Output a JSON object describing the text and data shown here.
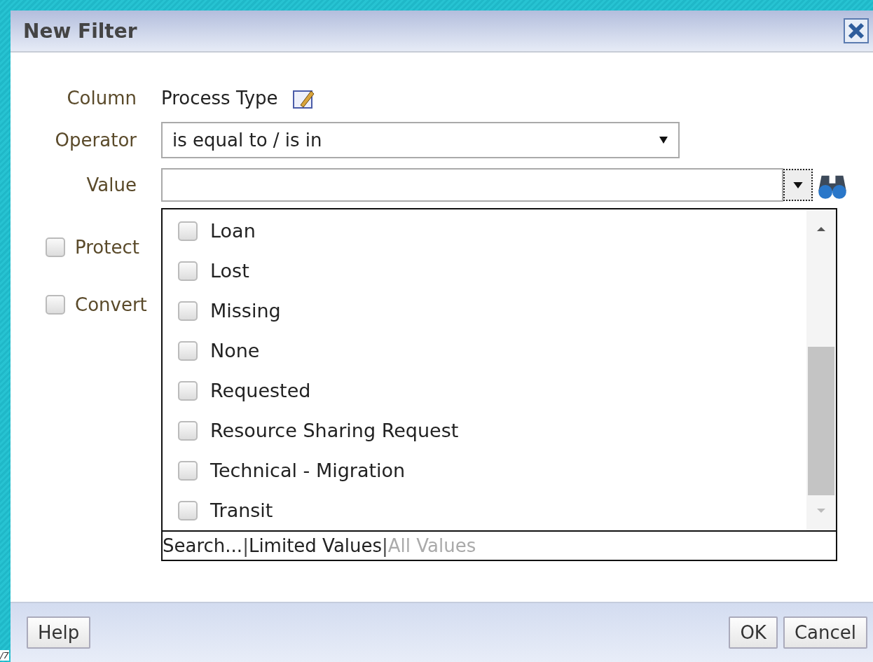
{
  "page_number": "/7",
  "dialog": {
    "title": "New Filter"
  },
  "form": {
    "column_label": "Column",
    "column_value": "Process Type",
    "operator_label": "Operator",
    "operator_value": "is equal to / is in",
    "value_label": "Value"
  },
  "options": [
    {
      "label": "Protect",
      "checked": false
    },
    {
      "label": "Convert",
      "checked": false
    }
  ],
  "value_list": {
    "items": [
      {
        "label": "Loan",
        "checked": false
      },
      {
        "label": "Lost",
        "checked": false
      },
      {
        "label": "Missing",
        "checked": false
      },
      {
        "label": "None",
        "checked": false
      },
      {
        "label": "Requested",
        "checked": false
      },
      {
        "label": "Resource Sharing Request",
        "checked": false
      },
      {
        "label": "Technical - Migration",
        "checked": false
      },
      {
        "label": "Transit",
        "checked": false
      }
    ],
    "links": [
      {
        "label": "Search...",
        "disabled": false
      },
      {
        "label": "Limited Values",
        "disabled": false
      },
      {
        "label": "All Values",
        "disabled": true
      }
    ],
    "separator": "|"
  },
  "buttons": {
    "left": [
      "Help"
    ],
    "right": [
      "OK",
      "Cancel"
    ]
  }
}
